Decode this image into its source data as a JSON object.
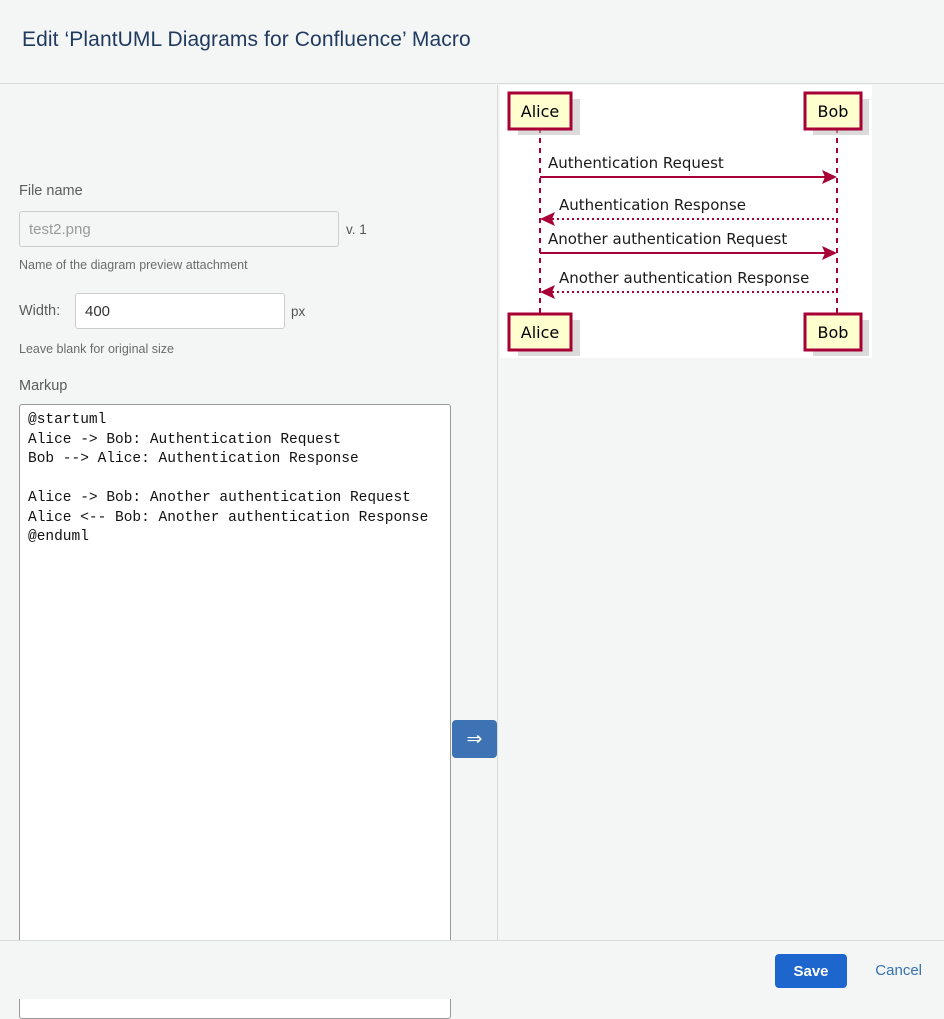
{
  "header": {
    "title": "Edit ‘PlantUML Diagrams for Confluence’ Macro"
  },
  "form": {
    "filename": {
      "label": "File name",
      "placeholder": "test2.png",
      "value": "",
      "version": "v. 1",
      "help": "Name of the diagram preview attachment"
    },
    "width": {
      "label": "Width:",
      "value": "400",
      "unit": "px",
      "help": "Leave blank for original size"
    },
    "markup": {
      "label": "Markup",
      "value": "@startuml\nAlice -> Bob: Authentication Request\nBob --> Alice: Authentication Response\n\nAlice -> Bob: Another authentication Request\nAlice <-- Bob: Another authentication Response\n@enduml"
    },
    "refresh_button": {
      "glyph": "⇒",
      "icon": "double-arrow-right-icon"
    }
  },
  "preview": {
    "diagram": {
      "type": "sequence-diagram",
      "participants": [
        "Alice",
        "Bob"
      ],
      "messages": [
        {
          "from": "Alice",
          "to": "Bob",
          "label": "Authentication Request",
          "style": "solid"
        },
        {
          "from": "Bob",
          "to": "Alice",
          "label": "Authentication Response",
          "style": "dotted"
        },
        {
          "from": "Alice",
          "to": "Bob",
          "label": "Another authentication Request",
          "style": "solid"
        },
        {
          "from": "Bob",
          "to": "Alice",
          "label": "Another authentication Response",
          "style": "dotted"
        }
      ],
      "colors": {
        "box_fill": "#fefece",
        "box_border": "#a80036",
        "line": "#a80036",
        "text": "#000000",
        "background": "#ffffff"
      },
      "participant_labels": {
        "alice_top": "Alice",
        "bob_top": "Bob",
        "alice_bottom": "Alice",
        "bob_bottom": "Bob"
      },
      "message_labels": {
        "m1": "Authentication Request",
        "m2": "Authentication Response",
        "m3": "Another authentication Request",
        "m4": "Another authentication Response"
      }
    }
  },
  "footer": {
    "save_label": "Save",
    "cancel_label": "Cancel",
    "accent_color": "#1d66cd"
  }
}
